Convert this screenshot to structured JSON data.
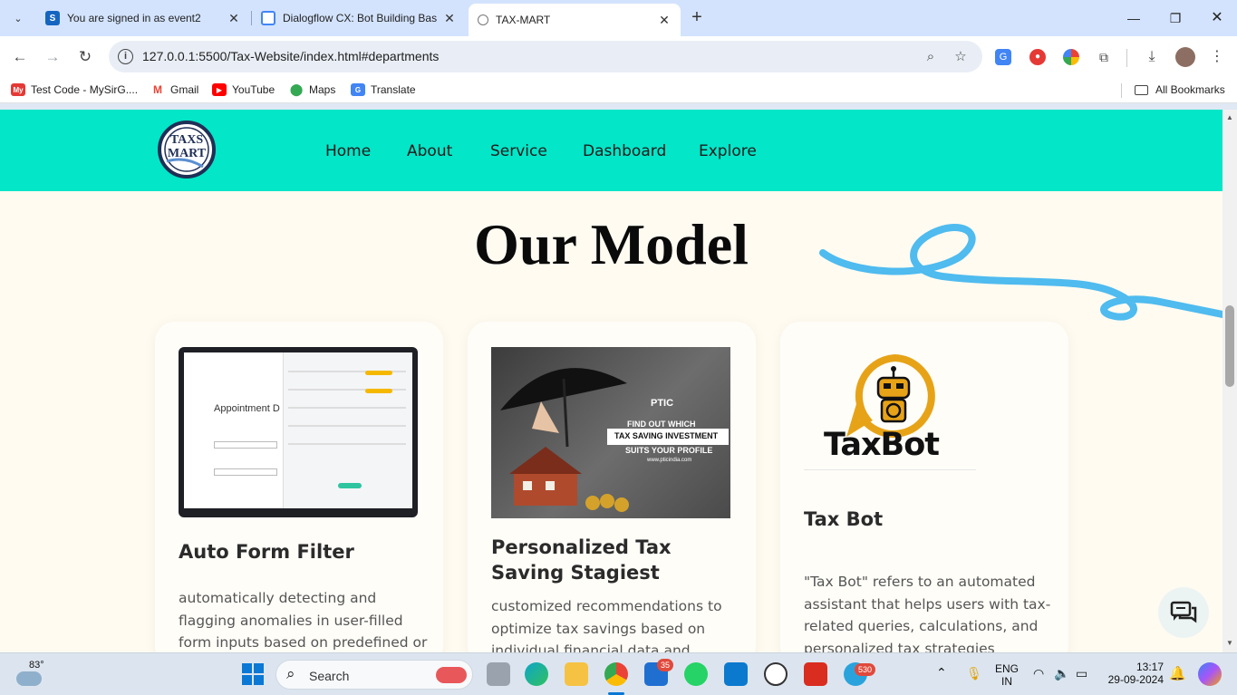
{
  "browser": {
    "tabs": [
      {
        "title": "You are signed in as event2",
        "icon": "s-logo-icon"
      },
      {
        "title": "Dialogflow CX: Bot Building Bas",
        "icon": "google-cloud-icon"
      },
      {
        "title": "TAX-MART",
        "icon": "globe-icon",
        "active": true
      }
    ],
    "url": "127.0.0.1:5500/Tax-Website/index.html#departments",
    "bookmarks": [
      {
        "label": "Test Code - MySirG....",
        "color": "#e53935"
      },
      {
        "label": "Gmail",
        "color": "#ea4335"
      },
      {
        "label": "YouTube",
        "color": "#ff0000"
      },
      {
        "label": "Maps",
        "color": "#34a853"
      },
      {
        "label": "Translate",
        "color": "#4285f4"
      }
    ],
    "all_bookmarks": "All Bookmarks"
  },
  "site": {
    "logo_text": "TAXS MART",
    "nav": [
      "Home",
      "About",
      "Service",
      "Dashboard",
      "Explore"
    ],
    "heading": "Our Model",
    "cards": [
      {
        "title": "Auto Form Filter",
        "text": "automatically detecting and flagging anomalies in user-filled form inputs based on predefined or",
        "image_text": "Appointment D"
      },
      {
        "title": "Personalized Tax Saving Stagiest",
        "text": "customized recommendations to optimize tax savings based on individual financial data and",
        "image_lines": [
          "PTIC",
          "FIND OUT WHICH",
          "TAX SAVING INVESTMENT",
          "SUITS YOUR PROFILE",
          "www.pticindia.com"
        ]
      },
      {
        "title": "Tax Bot",
        "text": "\"Tax Bot\" refers to an automated assistant that helps users with tax-related queries, calculations, and personalized tax strategies",
        "image_text": "TaxBot"
      }
    ]
  },
  "taskbar": {
    "weather": "83°",
    "search_placeholder": "Search",
    "lang_line1": "ENG",
    "lang_line2": "IN",
    "time": "13:17",
    "date": "29-09-2024",
    "badge_store": "35",
    "badge_telegram": "530"
  }
}
